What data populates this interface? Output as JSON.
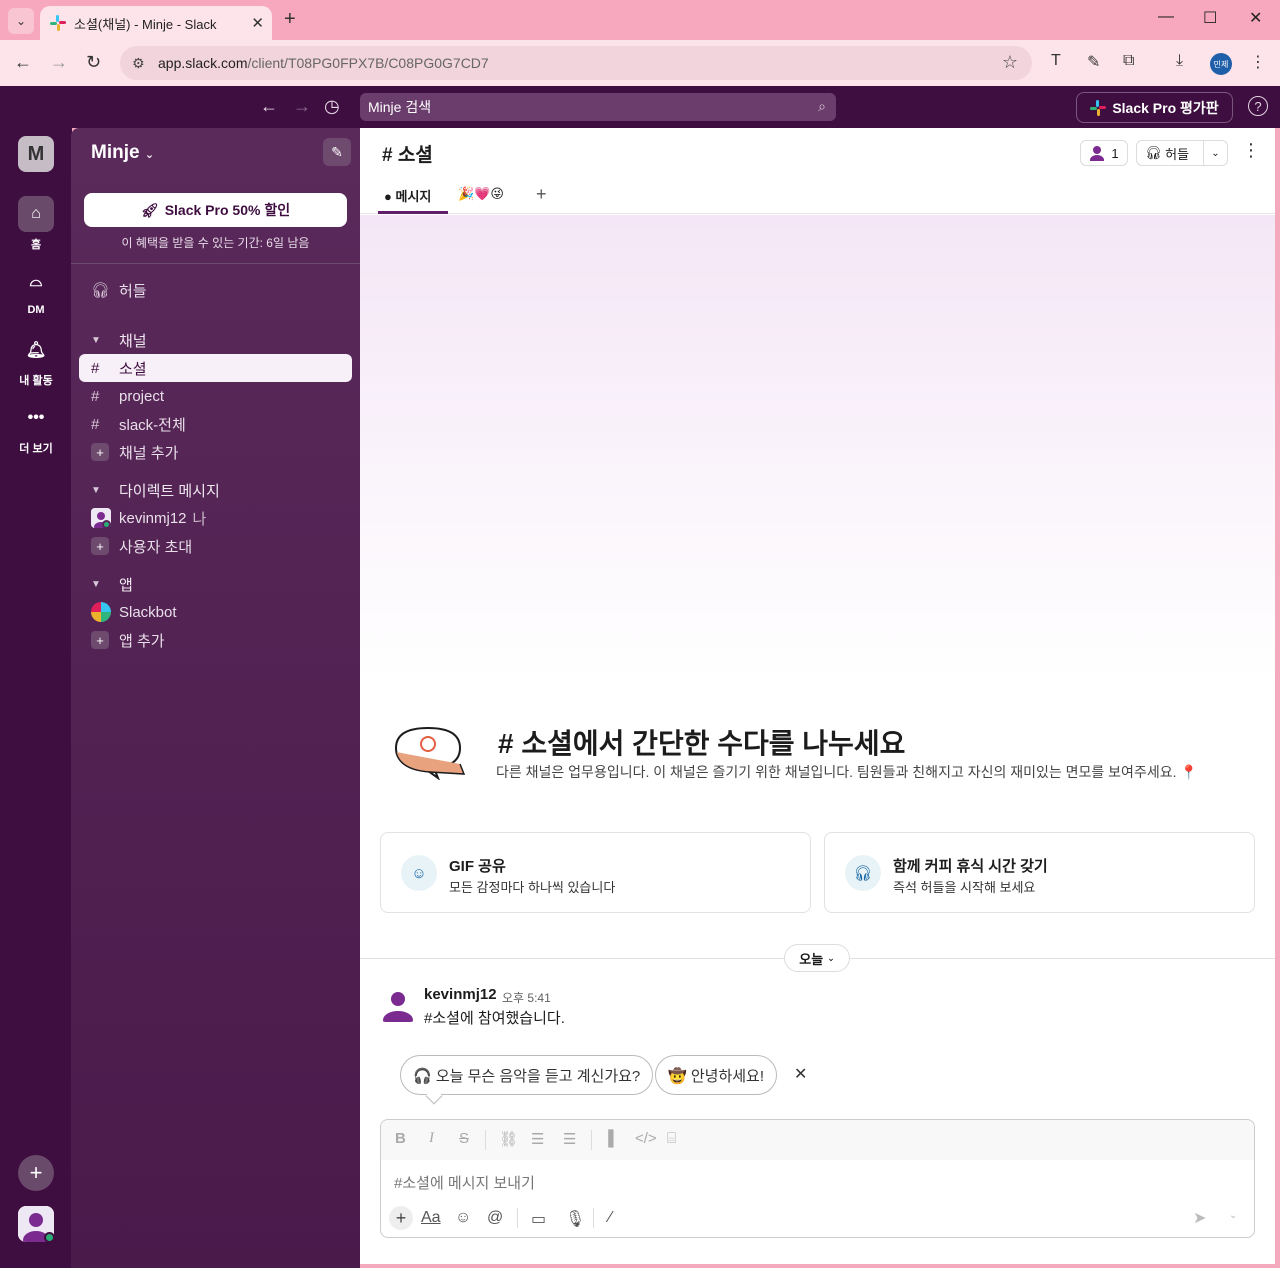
{
  "browser": {
    "tab_title": "소셜(채널) - Minje - Slack",
    "url_host": "app.slack.com",
    "url_path": "/client/T08PG0FPX7B/C08PG0G7CD7",
    "profile_label": "민제"
  },
  "topbar": {
    "search_placeholder": "Minje 검색",
    "pro_trial_label": "Slack Pro 평가판"
  },
  "rail": {
    "workspace_initial": "M",
    "items": [
      {
        "label": "홈",
        "icon": "home-icon"
      },
      {
        "label": "DM",
        "icon": "dm-icon"
      },
      {
        "label": "내 활동",
        "icon": "bell-icon"
      },
      {
        "label": "더 보기",
        "icon": "more-icon"
      }
    ]
  },
  "sidebar": {
    "workspace_name": "Minje",
    "promo_label": "Slack Pro 50% 할인",
    "promo_sub": "이 혜택을 받을 수 있는 기간: 6일 남음",
    "huddle_label": "허들",
    "channels_section": "채널",
    "channels": [
      "소셜",
      "project",
      "slack-전체"
    ],
    "add_channel": "채널 추가",
    "dm_section": "다이렉트 메시지",
    "dm_user": "kevinmj12",
    "dm_you": "나",
    "invite_label": "사용자 초대",
    "apps_section": "앱",
    "app_name": "Slackbot",
    "add_app": "앱 추가"
  },
  "channel": {
    "title": "소셜",
    "member_count": "1",
    "huddle_label": "허들",
    "tabs": [
      "메시지",
      "🎉💗😜"
    ],
    "intro_title": "소셜에서 간단한 수다를 나누세요",
    "intro_desc": "다른 채널은 업무용입니다. 이 채널은 즐기기 위한 채널입니다. 팀원들과 친해지고 자신의 재미있는 면모를 보여주세요.",
    "cards": [
      {
        "title": "GIF 공유",
        "sub": "모든 감정마다 하나씩 있습니다"
      },
      {
        "title": "함께 커피 휴식 시간 갖기",
        "sub": "즉석 허들을 시작해 보세요"
      }
    ],
    "date_label": "오늘",
    "message": {
      "user": "kevinmj12",
      "time": "오후 5:41",
      "text": "#소셜에 참여했습니다."
    },
    "suggestions": [
      "🎧 오늘 무슨 음악을 듣고 계신가요?",
      "🤠 안녕하세요!"
    ],
    "composer_placeholder": "#소셜에 메시지 보내기"
  },
  "colors": {
    "aubergine": "#3f0e40",
    "sidebar": "#5a2a5b",
    "browser_frame": "#f7a8bf",
    "active_item_bg": "#f8f0f8"
  }
}
